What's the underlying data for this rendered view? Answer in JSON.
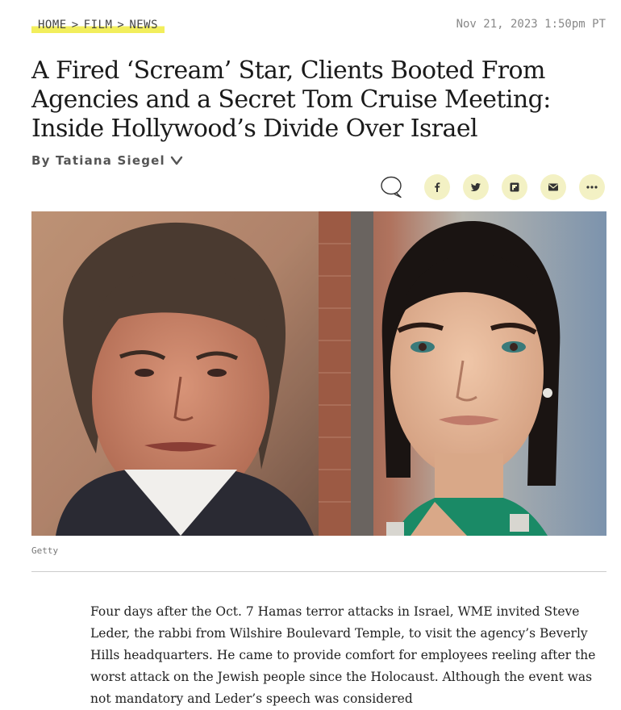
{
  "breadcrumb": {
    "items": [
      "HOME",
      "FILM",
      "NEWS"
    ],
    "separator": ">"
  },
  "date": "Nov 21, 2023 1:50pm PT",
  "headline": "A Fired ‘Scream’ Star, Clients Booted From Agencies and a Secret Tom Cruise Meeting: Inside Hollywood’s Divide Over Israel",
  "byline": "By Tatiana Siegel",
  "share": {
    "icons": [
      "comment-icon",
      "facebook-icon",
      "twitter-icon",
      "flipboard-icon",
      "email-icon",
      "more-icon"
    ],
    "button_color": "#f3f1c4"
  },
  "image": {
    "caption": "Getty"
  },
  "body": {
    "paragraph": "Four days after the Oct. 7 Hamas terror attacks in Israel, WME invited Steve Leder, the rabbi from Wilshire Boulevard Temple, to visit the agency’s Beverly Hills headquarters. He came to provide comfort for employees reeling after the worst attack on the Jewish people since the Holocaust. Although the event was not mandatory and Leder’s speech was considered"
  },
  "colors": {
    "highlight": "#f2ee5c",
    "text": "#1a1a1a",
    "muted": "#888888"
  }
}
